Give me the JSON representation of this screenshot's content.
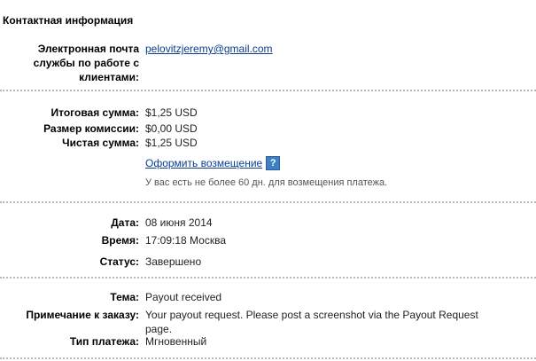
{
  "contact": {
    "title": "Контактная информация",
    "email_label": "Электронная почта службы по работе с клиентами:",
    "email": "pelovitzjeremy@gmail.com"
  },
  "amounts": {
    "total_label": "Итоговая сумма:",
    "total_value": "$1,25 USD",
    "fee_label": "Размер комиссии:",
    "fee_value": "$0,00 USD",
    "net_label": "Чистая сумма:",
    "net_value": "$1,25 USD",
    "refund_link": "Оформить возмещение",
    "help_icon": "?",
    "refund_note": "У вас есть не более 60 дн. для возмещения платежа."
  },
  "details": {
    "date_label": "Дата:",
    "date_value": "08 июня 2014",
    "time_label": "Время:",
    "time_value": "17:09:18 Москва",
    "status_label": "Статус:",
    "status_value": "Завершено"
  },
  "order": {
    "subject_label": "Тема:",
    "subject_value": "Payout received",
    "note_label": "Примечание к заказу:",
    "note_value": "Your payout request. Please post a screenshot via the Payout Request page.",
    "type_label": "Тип платежа:",
    "type_value": "Мгновенный"
  }
}
